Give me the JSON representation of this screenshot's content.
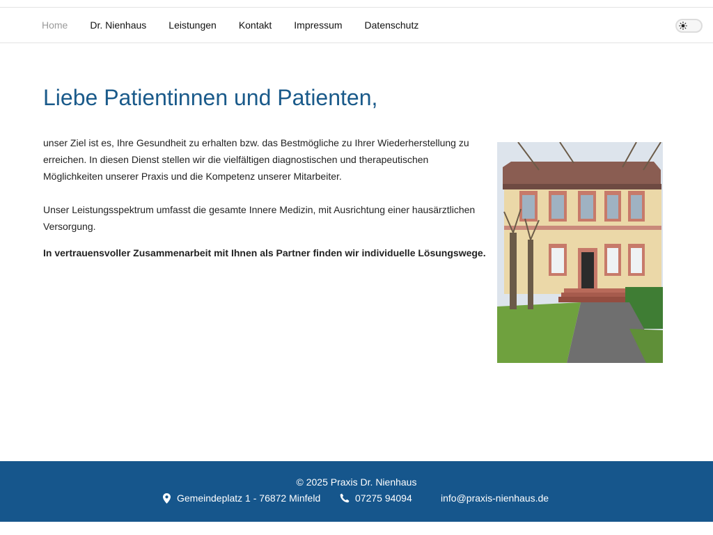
{
  "nav": {
    "items": [
      {
        "label": "Home",
        "active": true
      },
      {
        "label": "Dr. Nienhaus"
      },
      {
        "label": "Leistungen"
      },
      {
        "label": "Kontakt"
      },
      {
        "label": "Impressum"
      },
      {
        "label": "Datenschutz"
      }
    ],
    "theme_toggle_icon": "sun-icon"
  },
  "main": {
    "title": "Liebe Patientinnen und Patienten,",
    "paragraphs": [
      "unser Ziel ist es, Ihre Gesundheit zu erhalten bzw. das Bestmögliche zu Ihrer Wiederherstellung zu erreichen. In diesen Dienst stellen wir die vielfältigen diagnostischen und therapeutischen Möglichkeiten unserer Praxis und die Kompetenz unserer Mitarbeiter.",
      "Unser Leistungsspektrum umfasst die gesamte Innere Medizin, mit Ausrichtung einer hausärztlichen Versorgung."
    ],
    "bold_text": "In vertrauensvoller Zusammenarbeit mit Ihnen als Partner finden wir individuelle Lösungswege.",
    "image_icon": "practice-building-photo"
  },
  "footer": {
    "copyright": "© 2025 Praxis Dr. Nienhaus",
    "address": "Gemeindeplatz 1 - 76872 Minfeld",
    "phone": "07275 94094",
    "email": "info@praxis-nienhaus.de",
    "address_icon": "map-pin-icon",
    "phone_icon": "phone-icon"
  },
  "colors": {
    "title": "#1a5a8a",
    "footer_bg": "#16568c",
    "nav_active": "#9a9a9a"
  }
}
